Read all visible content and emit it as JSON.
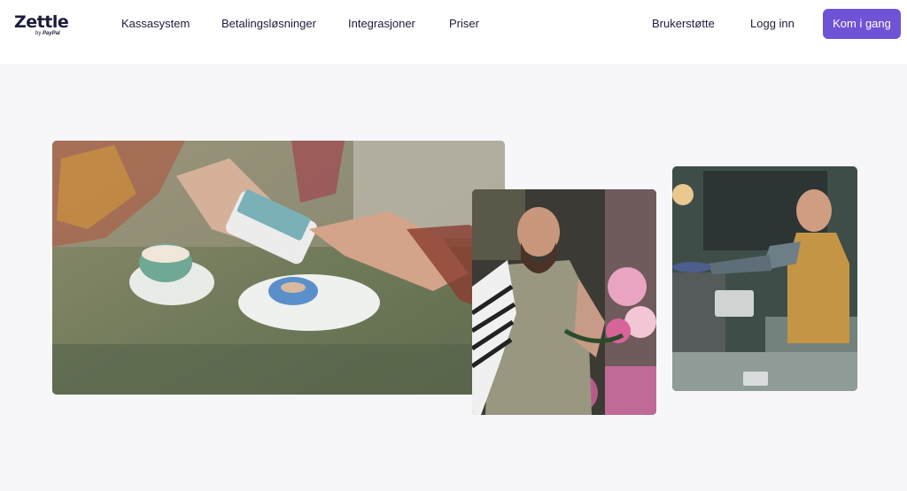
{
  "header": {
    "logo_name": "Zettle",
    "logo_by": "by",
    "logo_brand": "PayPal",
    "nav": [
      {
        "label": "Kassasystem"
      },
      {
        "label": "Betalingsløsninger"
      },
      {
        "label": "Integrasjoner"
      },
      {
        "label": "Priser"
      }
    ],
    "support_label": "Brukerstøtte",
    "login_label": "Logg inn",
    "cta_label": "Kom i gang"
  },
  "colors": {
    "brand_purple": "#6e53d6",
    "text_dark": "#1c1c3c",
    "page_bg": "#f7f7f9"
  }
}
